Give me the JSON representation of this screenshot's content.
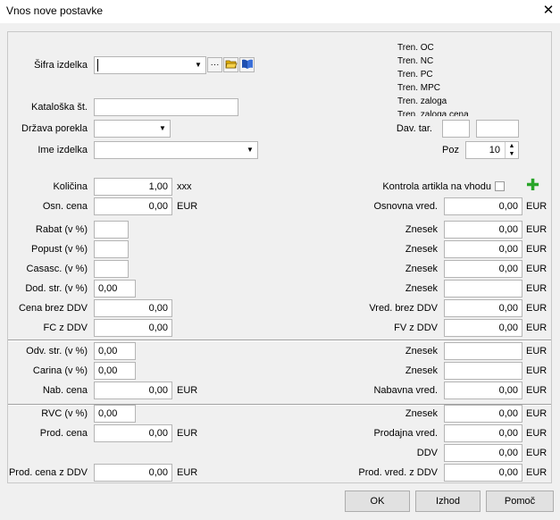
{
  "window": {
    "title": "Vnos nove postavke",
    "close_glyph": "✕"
  },
  "info": {
    "tren_oc": "Tren. OC",
    "tren_nc": "Tren. NC",
    "tren_pc": "Tren. PC",
    "tren_mpc": "Tren. MPC",
    "tren_zaloga": "Tren. zaloga",
    "tren_zaloga_cena": "Tren. zaloga cena"
  },
  "header": {
    "sifra_label": "Šifra izdelka",
    "sifra_value": "",
    "more_glyph": "···",
    "kataloska_label": "Kataloška št.",
    "kataloska_value": "",
    "drzava_label": "Država porekla",
    "drzava_value": "",
    "ime_label": "Ime izdelka",
    "ime_value": "",
    "dav_tar_label": "Dav. tar.",
    "dav_tar_value_1": "",
    "dav_tar_value_2": "",
    "poz_label": "Poz",
    "poz_value": "10"
  },
  "left": {
    "kolicina_label": "Količina",
    "kolicina_value": "1,00",
    "kolicina_unit": "xxx",
    "osn_cena_label": "Osn. cena",
    "osn_cena_value": "0,00",
    "rabat_label": "Rabat (v %)",
    "rabat_value": "",
    "popust_label": "Popust (v %)",
    "popust_value": "",
    "casasc_label": "Casasc. (v %)",
    "casasc_value": "",
    "dod_str_label": "Dod. str. (v %)",
    "dod_str_value": "0,00",
    "cena_brez_ddv_label": "Cena brez DDV",
    "cena_brez_ddv_value": "0,00",
    "fc_z_ddv_label": "FC z DDV",
    "fc_z_ddv_value": "0,00",
    "odv_str_label": "Odv. str. (v %)",
    "odv_str_value": "0,00",
    "carina_label": "Carina (v %)",
    "carina_value": "0,00",
    "nab_cena_label": "Nab. cena",
    "nab_cena_value": "0,00",
    "rvc_label": "RVC (v %)",
    "rvc_value": "0,00",
    "prod_cena_label": "Prod. cena",
    "prod_cena_value": "0,00",
    "prod_cena_ddv_label": "Prod. cena z DDV",
    "prod_cena_ddv_value": "0,00"
  },
  "right": {
    "kontrola_label": "Kontrola artikla na vhodu",
    "plus_glyph": "✚",
    "osnovna_vred_label": "Osnovna vred.",
    "osnovna_vred_value": "0,00",
    "znesek_label": "Znesek",
    "znesek_rabat_value": "0,00",
    "znesek_popust_value": "0,00",
    "znesek_casasc_value": "0,00",
    "znesek_dod_value": "",
    "vred_brez_ddv_label": "Vred. brez DDV",
    "vred_brez_ddv_value": "0,00",
    "fv_z_ddv_label": "FV z DDV",
    "fv_z_ddv_value": "0,00",
    "znesek_odv_value": "",
    "znesek_carina_value": "",
    "nabavna_vred_label": "Nabavna vred.",
    "nabavna_vred_value": "0,00",
    "znesek_rvc_value": "0,00",
    "prodajna_vred_label": "Prodajna vred.",
    "prodajna_vred_value": "0,00",
    "ddv_label": "DDV",
    "ddv_value": "0,00",
    "prod_vred_ddv_label": "Prod. vred. z DDV",
    "prod_vred_ddv_value": "0,00"
  },
  "currency": "EUR",
  "buttons": {
    "ok": "OK",
    "izhod": "Izhod",
    "pomoc": "Pomoč"
  },
  "colors": {
    "plus_green": "#2aa52a",
    "folder_yellow": "#e8b400",
    "book_blue": "#1f4fb0"
  }
}
